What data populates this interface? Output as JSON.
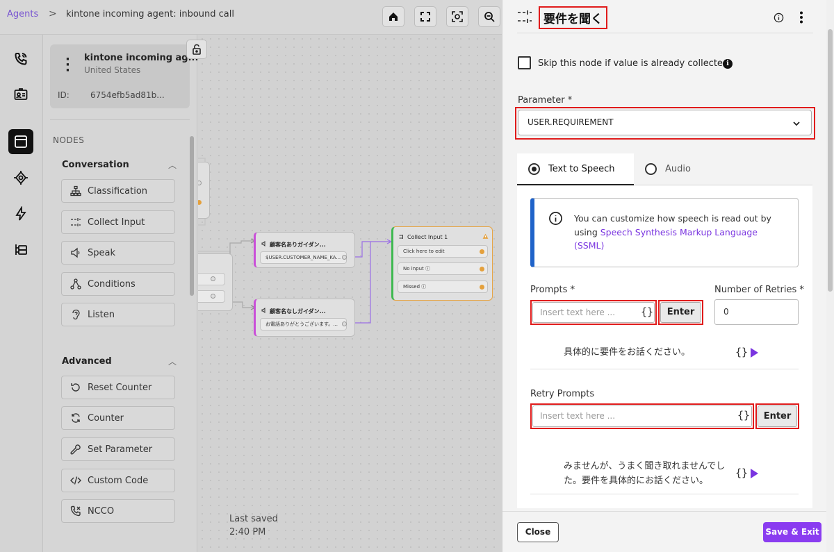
{
  "breadcrumb": {
    "root": "Agents",
    "separator": ">",
    "current": "kintone incoming agent: inbound call"
  },
  "agent": {
    "name": "kintone incoming ag...",
    "country": "United States",
    "id_label": "ID:",
    "id_value": "6754efb5ad81b..."
  },
  "palette": {
    "nodes_label": "NODES",
    "conversation": {
      "title": "Conversation",
      "items": [
        "Classification",
        "Collect Input",
        "Speak",
        "Conditions",
        "Listen"
      ]
    },
    "advanced": {
      "title": "Advanced",
      "items": [
        "Reset Counter",
        "Counter",
        "Set Parameter",
        "Custom Code",
        "NCCO"
      ]
    }
  },
  "flow": {
    "node_a": {
      "title": "顧客名ありガイダン...",
      "field": "$USER.CUSTOMER_NAME_KA..."
    },
    "node_b": {
      "title": "顧客名なしガイダン...",
      "field": "お電話ありがとうございます。..."
    },
    "collect": {
      "title": "Collect Input 1",
      "rows": [
        "Click here to edit",
        "No input",
        "Missed"
      ]
    }
  },
  "last_saved": {
    "label": "Last saved",
    "time": "2:40 PM"
  },
  "panel": {
    "title": "要件を聞く",
    "skip_label": "Skip this node if value is already collected",
    "parameter": {
      "label": "Parameter *",
      "value": "USER.REQUIREMENT"
    },
    "tabs": [
      "Text to Speech",
      "Audio"
    ],
    "info": {
      "text": "You can customize how speech is read out by using ",
      "link": "Speech Synthesis Markup Language (SSML)"
    },
    "prompts": {
      "label": "Prompts *",
      "placeholder": "Insert text here ...",
      "enter": "Enter",
      "value": "具体的に要件をお話ください。"
    },
    "retries": {
      "label": "Number of Retries *",
      "value": "0"
    },
    "retry_prompts": {
      "label": "Retry Prompts",
      "placeholder": "Insert text here ...",
      "enter": "Enter",
      "value_line1": "みませんが、うまく聞き取れませんでし",
      "value_line2": "た。要件を具体的にお話ください。"
    },
    "close": "Close",
    "save_exit": "Save & Exit"
  },
  "colors": {
    "accent": "#8a3cf0",
    "highlight": "#e01b1b",
    "info_bar": "#1f63c9"
  }
}
